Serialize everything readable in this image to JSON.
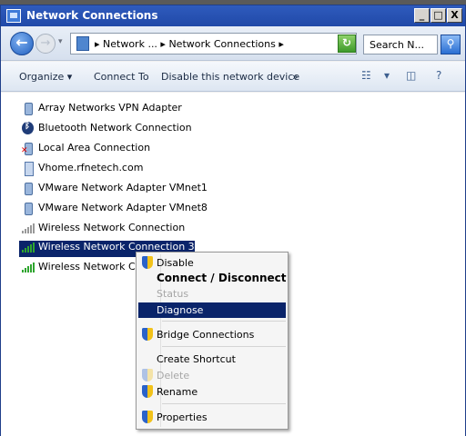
{
  "window": {
    "title": "Network Connections",
    "controls": {
      "minimize": "_",
      "maximize": "□",
      "close": "X"
    }
  },
  "address": {
    "breadcrumb": "▸ Network ... ▸ Network Connections ▸",
    "search_placeholder": "Search N..."
  },
  "commandbar": {
    "organize": "Organize ▾",
    "connect_to": "Connect To",
    "disable": "Disable this network device",
    "more": "»"
  },
  "connections": [
    {
      "name": "Array Networks VPN Adapter",
      "icon": "adapter-icon"
    },
    {
      "name": "Bluetooth Network Connection",
      "icon": "bluetooth-icon"
    },
    {
      "name": "Local Area Connection",
      "icon": "lan-disconnected-icon"
    },
    {
      "name": "Vhome.rfnetech.com",
      "icon": "vpn-icon"
    },
    {
      "name": "VMware Network Adapter VMnet1",
      "icon": "adapter-icon"
    },
    {
      "name": "VMware Network Adapter VMnet8",
      "icon": "adapter-icon"
    },
    {
      "name": "Wireless Network Connection",
      "icon": "wireless-signal-icon"
    },
    {
      "name": "Wireless Network Connection 3",
      "icon": "wireless-signal-icon",
      "selected": true
    },
    {
      "name": "Wireless Network Cor",
      "icon": "wireless-signal-icon"
    }
  ],
  "context_menu": {
    "disable": "Disable",
    "connect_disconnect": "Connect / Disconnect",
    "status": "Status",
    "diagnose": "Diagnose",
    "bridge": "Bridge Connections",
    "shortcut": "Create Shortcut",
    "delete": "Delete",
    "rename": "Rename",
    "properties": "Properties"
  },
  "colors": {
    "titlebar": "#2049a8",
    "selection": "#0a246a"
  }
}
